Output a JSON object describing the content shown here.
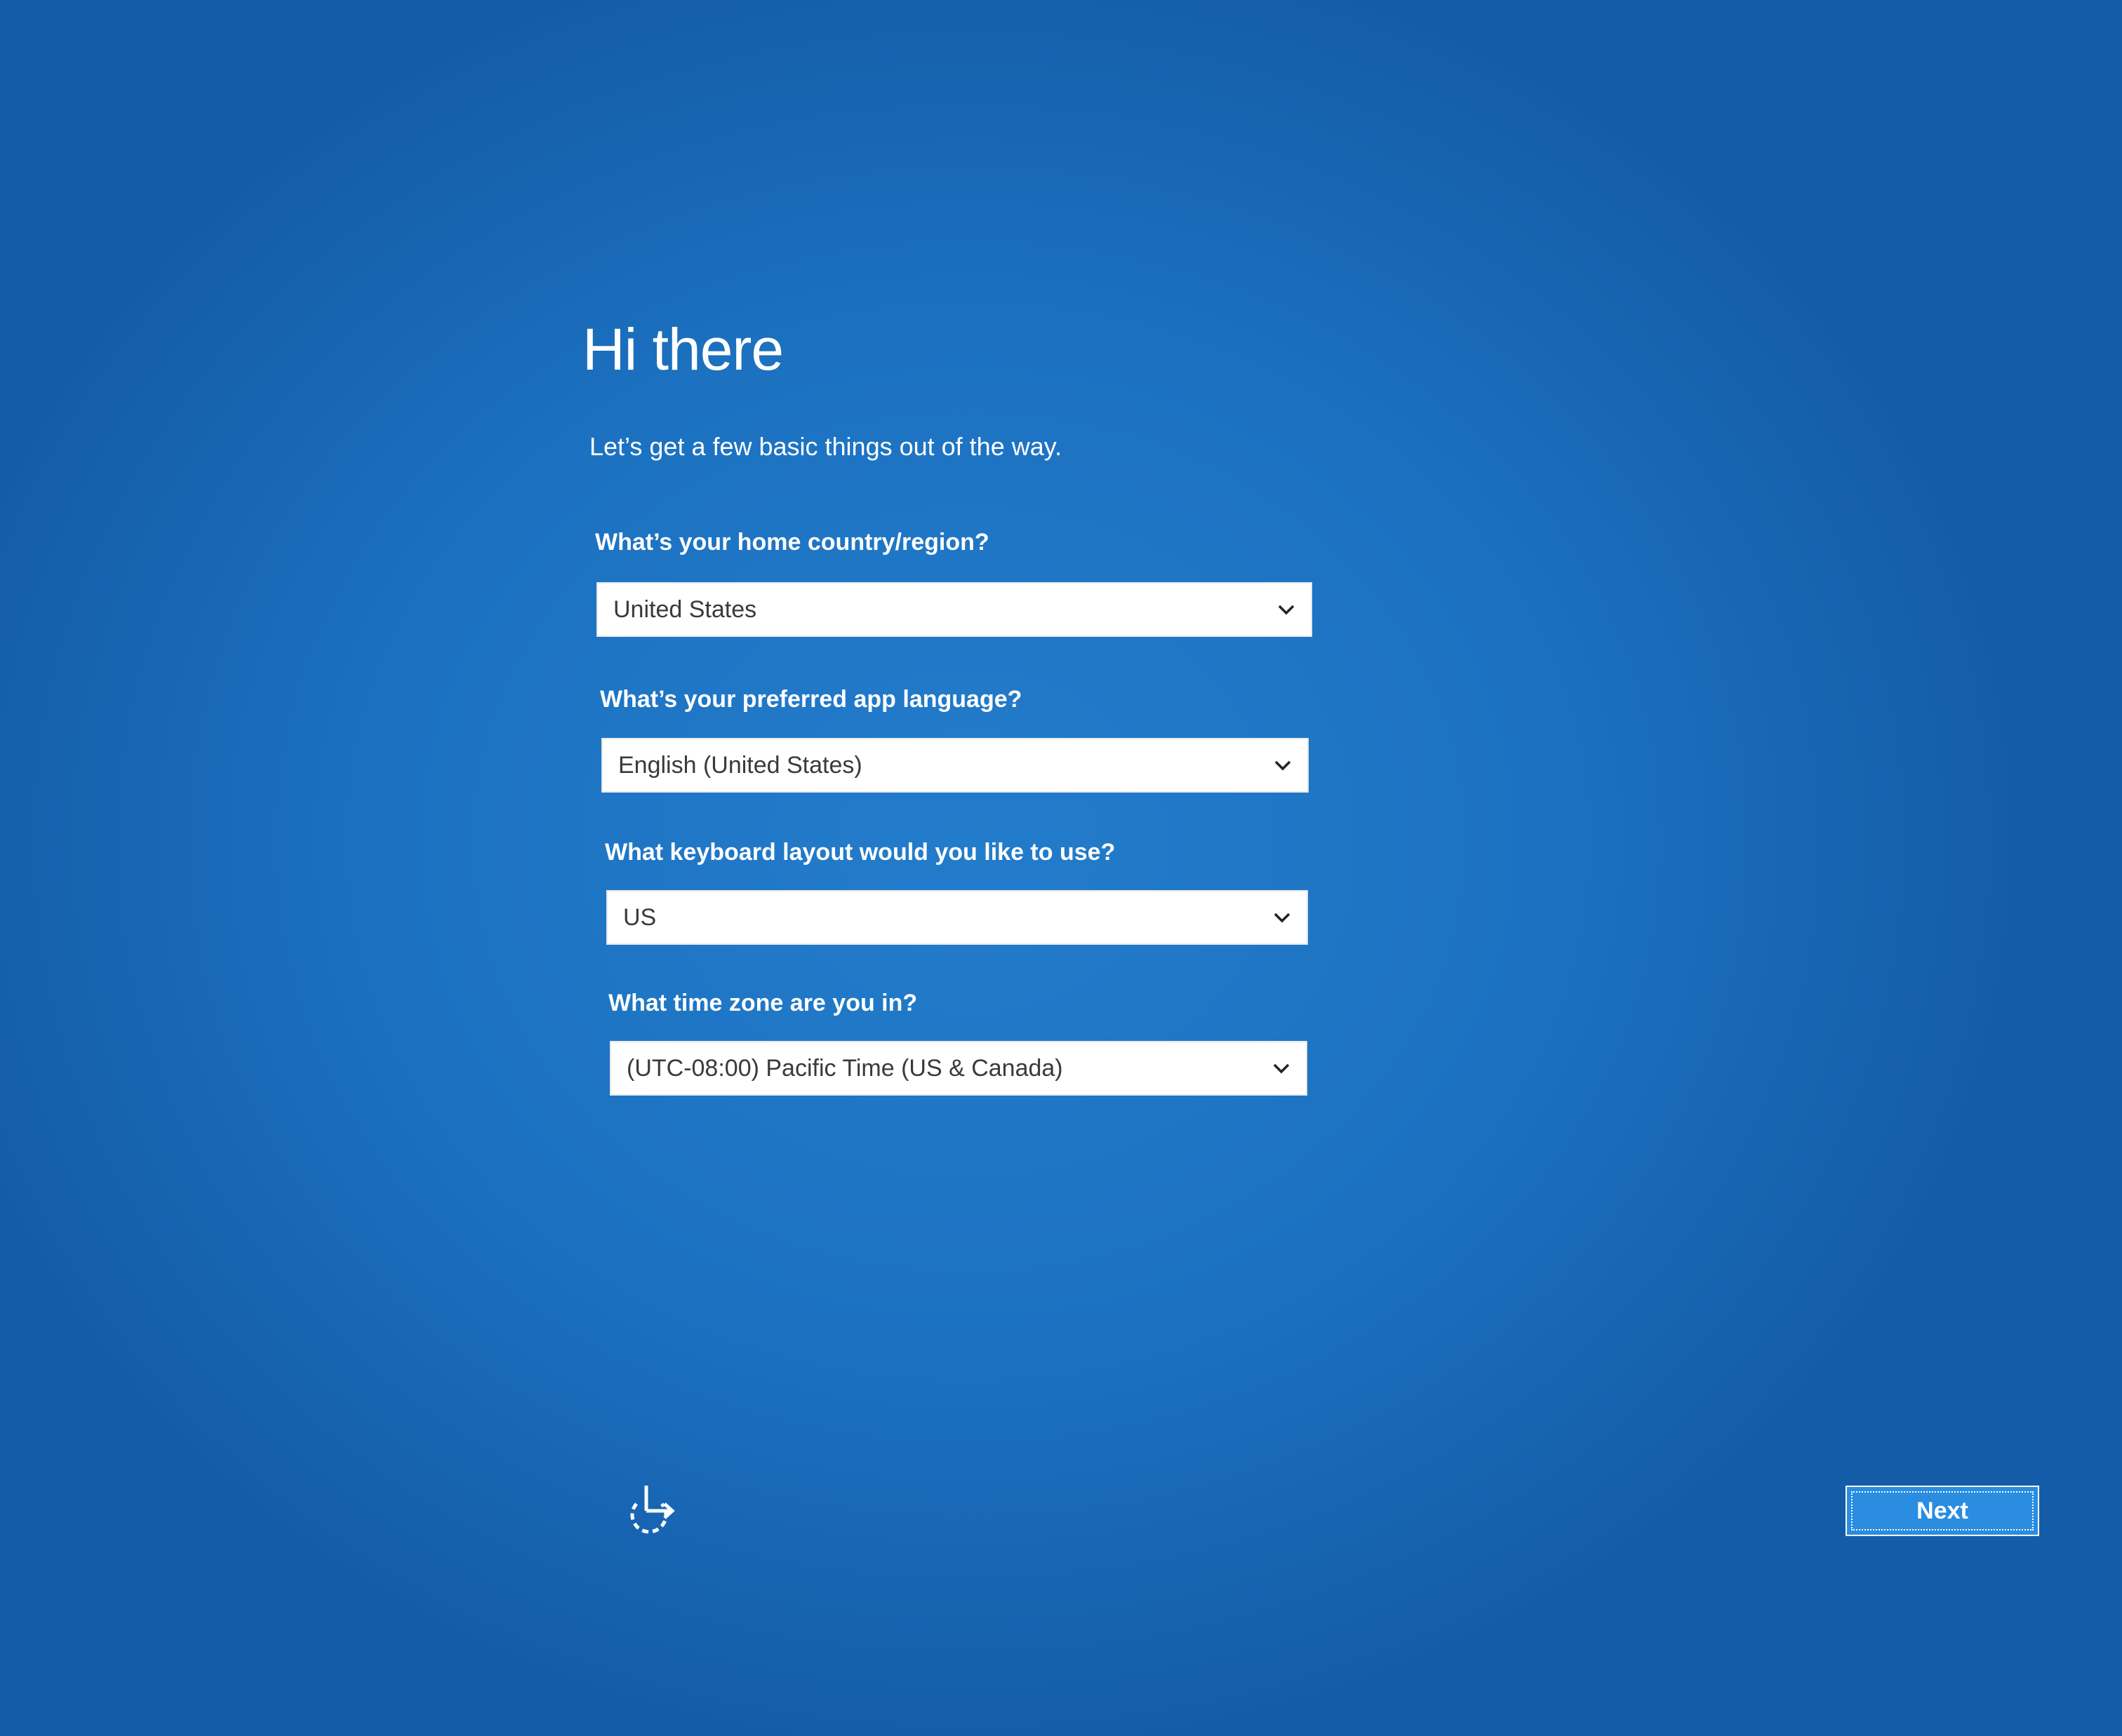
{
  "header": {
    "title": "Hi there",
    "subtitle": "Let’s get a few basic things out of the way."
  },
  "form": {
    "country": {
      "question": "What’s your home country/region?",
      "value": "United States"
    },
    "language": {
      "question": "What’s your preferred app language?",
      "value": "English (United States)"
    },
    "keyboard": {
      "question": "What keyboard layout would you like to use?",
      "value": "US"
    },
    "timezone": {
      "question": "What time zone are you in?",
      "value": "(UTC-08:00) Pacific Time (US & Canada)"
    }
  },
  "footer": {
    "ease_of_access_icon": "ease-of-access-icon",
    "next_label": "Next"
  },
  "colors": {
    "background": "#1d73c2",
    "button": "#2a8de0",
    "field": "#ffffff"
  }
}
